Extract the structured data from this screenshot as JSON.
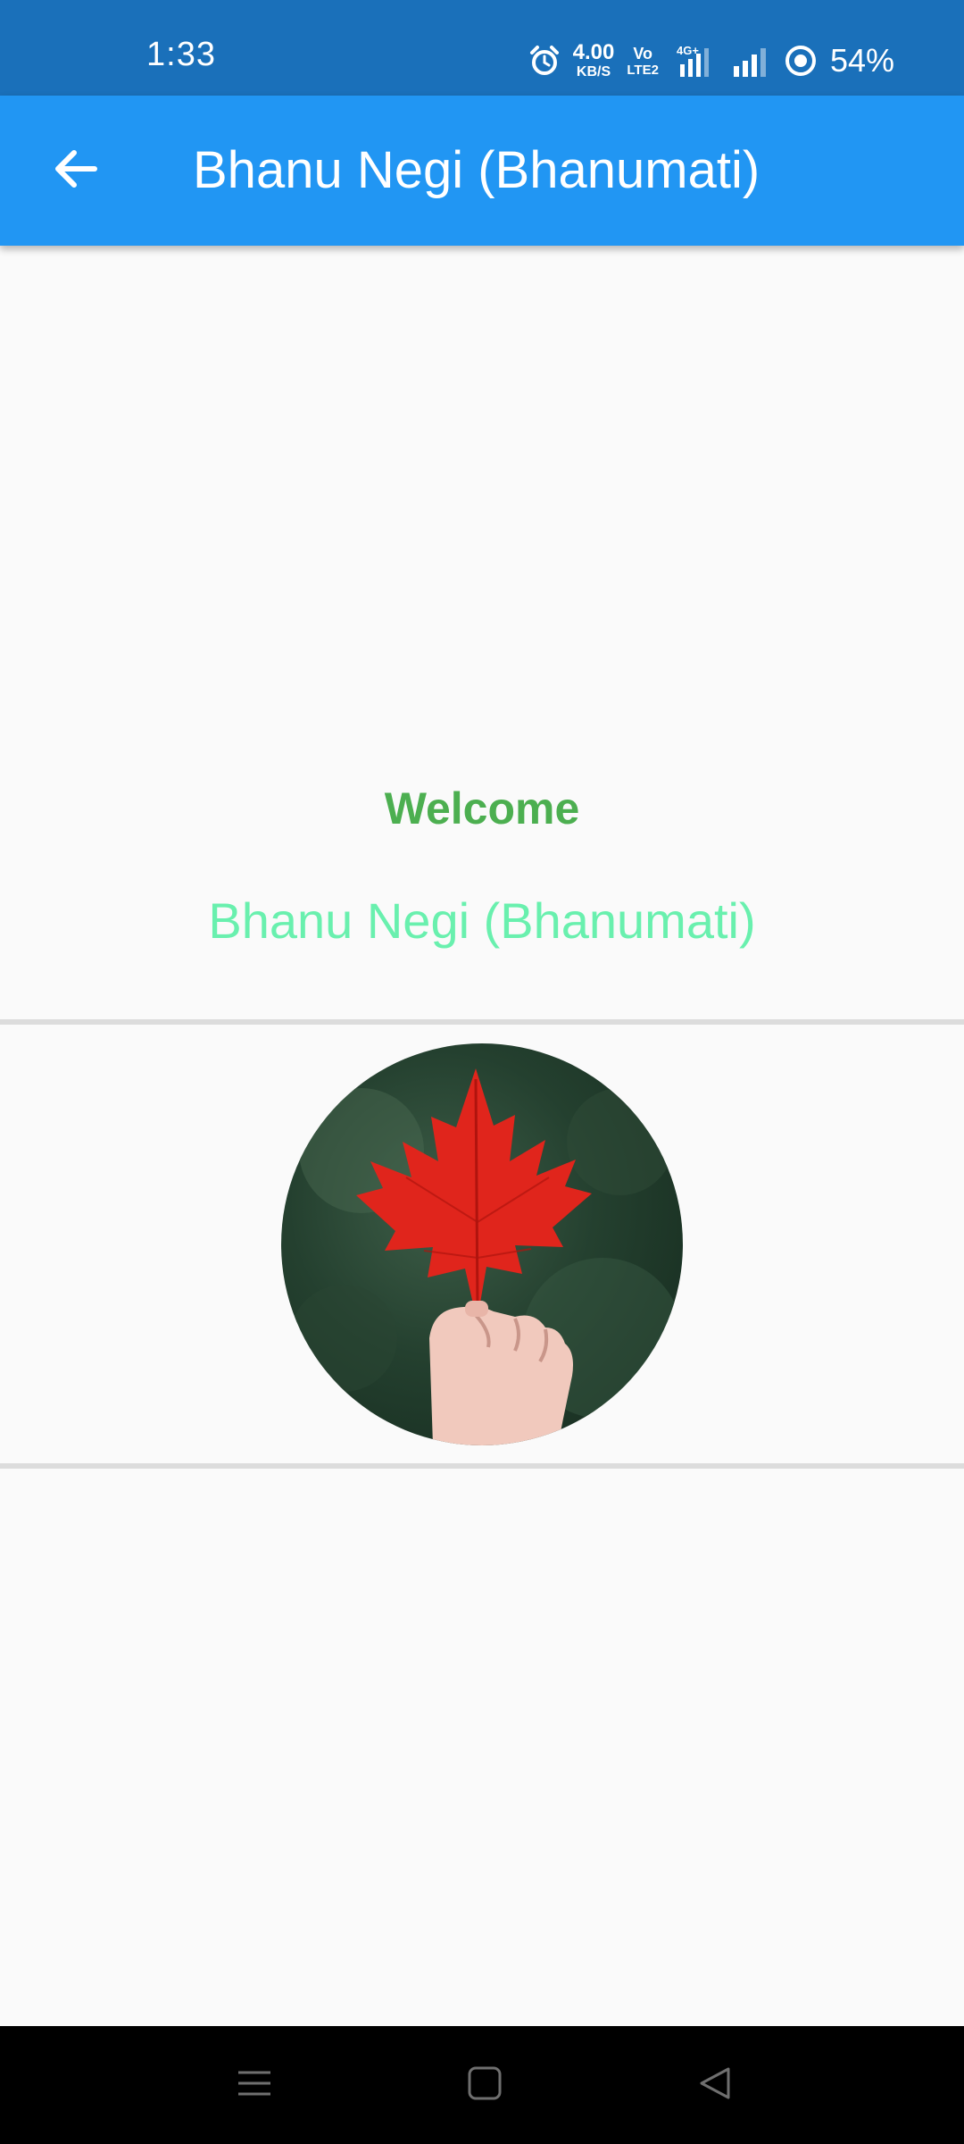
{
  "status_bar": {
    "time": "1:33",
    "net_speed_value": "4.00",
    "net_speed_unit": "KB/S",
    "volte_top": "Vo",
    "volte_bottom": "LTE2",
    "network_type": "4G+",
    "battery_percent": "54%",
    "icons": [
      "alarm-icon",
      "signal-4g-icon",
      "signal-icon",
      "battery-saver-icon"
    ]
  },
  "app_bar": {
    "title": "Bhanu Negi (Bhanumati)",
    "back_icon": "arrow-left-icon",
    "background": "#2196f3"
  },
  "content": {
    "welcome": "Welcome",
    "user_name": "Bhanu Negi (Bhanumati)",
    "welcome_color": "#4caf50",
    "user_name_color": "#69f0ae",
    "avatar": "profile-photo-red-maple-leaf-in-hand"
  },
  "nav_bar": {
    "buttons": [
      "menu-icon",
      "home-icon",
      "back-triangle-icon"
    ]
  }
}
